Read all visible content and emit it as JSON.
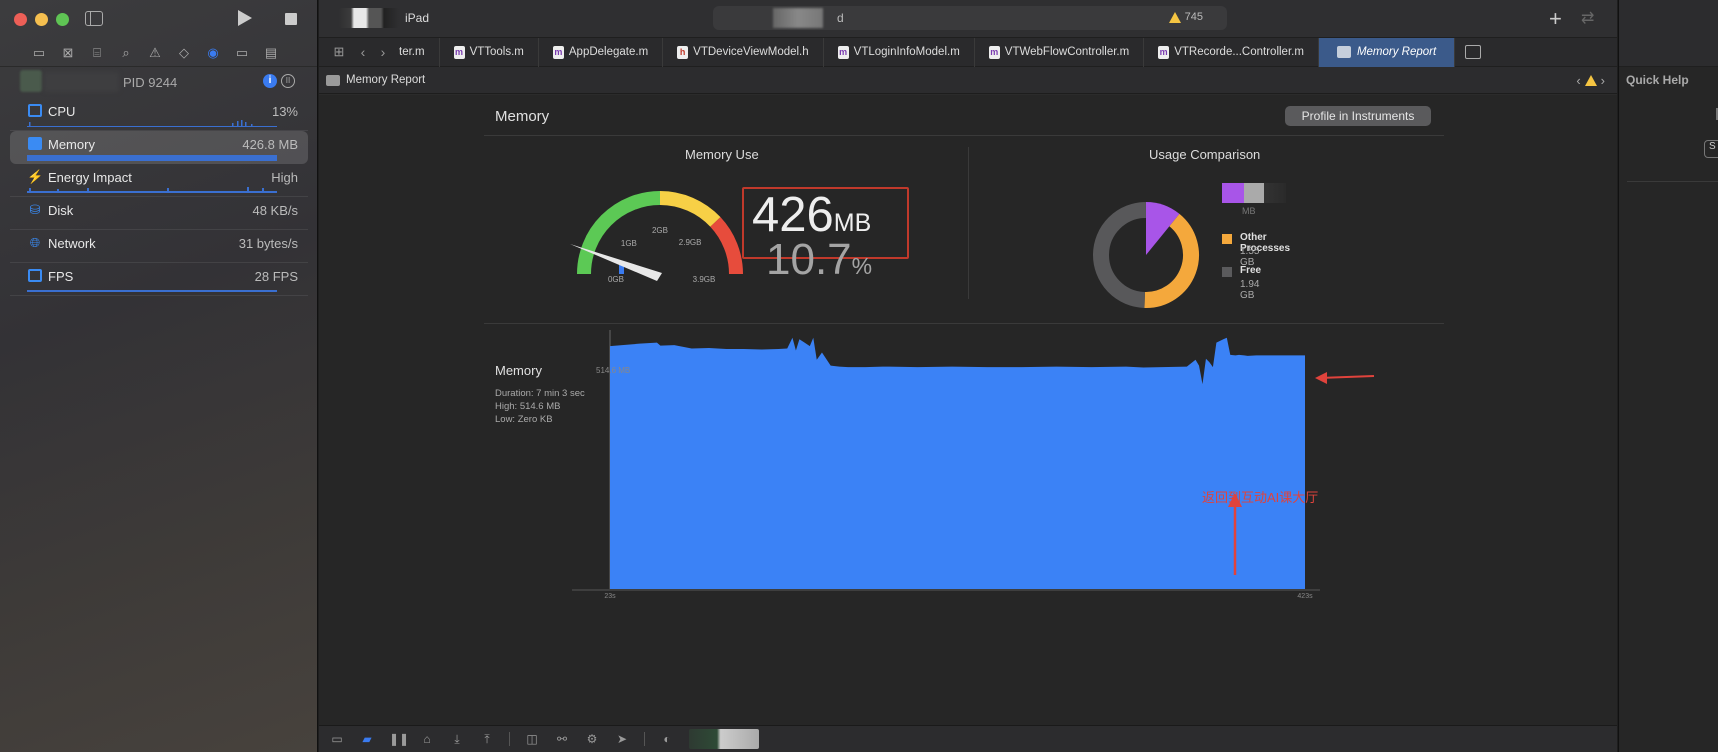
{
  "window": {
    "scheme_device": "iPad",
    "status_suffix": "d",
    "warning_count": "745"
  },
  "navigator_icons": [
    "folder-icon",
    "source-control-icon",
    "symbol-icon",
    "search-icon",
    "warning-icon",
    "test-icon",
    "debug-icon",
    "breakpoint-icon",
    "report-icon"
  ],
  "process": {
    "pid_label": "PID 9244"
  },
  "gauges": [
    {
      "name": "CPU",
      "value": "13%",
      "icon": "cpu-icon"
    },
    {
      "name": "Memory",
      "value": "426.8 MB",
      "icon": "memory-icon",
      "selected": true
    },
    {
      "name": "Energy Impact",
      "value": "High",
      "icon": "energy-icon"
    },
    {
      "name": "Disk",
      "value": "48 KB/s",
      "icon": "disk-icon"
    },
    {
      "name": "Network",
      "value": "31 bytes/s",
      "icon": "network-icon"
    },
    {
      "name": "FPS",
      "value": "28 FPS",
      "icon": "fps-icon"
    }
  ],
  "tabs": [
    {
      "label": "ter.m",
      "badge": ""
    },
    {
      "label": "VTTools.m",
      "badge": "m"
    },
    {
      "label": "AppDelegate.m",
      "badge": "m"
    },
    {
      "label": "VTDeviceViewModel.h",
      "badge": "h"
    },
    {
      "label": "VTLoginInfoModel.m",
      "badge": "m"
    },
    {
      "label": "VTWebFlowController.m",
      "badge": "m"
    },
    {
      "label": "VTRecorde...Controller.m",
      "badge": "m"
    },
    {
      "label": "Memory Report",
      "badge": "",
      "active": true
    }
  ],
  "pathbar": {
    "label": "Memory Report"
  },
  "report": {
    "title": "Memory",
    "profile_button": "Profile in Instruments",
    "memory_use": {
      "title": "Memory Use",
      "value": "426",
      "unit": "MB",
      "percent": "10.7",
      "percent_unit": "%",
      "gauge_labels": [
        "0GB",
        "1GB",
        "2GB",
        "2.9GB",
        "3.9GB"
      ],
      "gauge_max_gb": 3.9,
      "gauge_value_gb": 0.426
    },
    "usage_comparison": {
      "title": "Usage Comparison",
      "legend": [
        {
          "name": "",
          "value": "MB",
          "color": "#a855e8"
        },
        {
          "name": "Other Processes",
          "value": "1.55 GB",
          "color": "#f4a83c"
        },
        {
          "name": "Free",
          "value": "1.94 GB",
          "color": "#5a5a5c"
        }
      ]
    },
    "annotation": "返回到互动AI课大厅"
  },
  "chart_data": {
    "type": "area",
    "title": "Memory",
    "stats": [
      "Duration: 7 min 3 sec",
      "High: 514.6 MB",
      "Low: Zero KB"
    ],
    "y_max_label": "514.6 MB",
    "x_tick_labels": [
      "23s",
      "423s"
    ],
    "ylim": [
      0,
      514.6
    ],
    "xlim": [
      23,
      423
    ],
    "color": "#3b82f6",
    "x": [
      23,
      30,
      40,
      50,
      52,
      60,
      70,
      80,
      90,
      100,
      110,
      120,
      125,
      128,
      130,
      132,
      135,
      138,
      140,
      142,
      145,
      150,
      155,
      160,
      170,
      180,
      200,
      220,
      240,
      260,
      280,
      300,
      320,
      330,
      355,
      360,
      362,
      364,
      366,
      368,
      370,
      372,
      376,
      378,
      380,
      383,
      385,
      388,
      390,
      395,
      400,
      410,
      423
    ],
    "y": [
      498,
      500,
      503,
      505,
      499,
      500,
      493,
      494,
      492,
      492,
      491,
      492,
      493,
      515,
      489,
      512,
      505,
      498,
      515,
      470,
      485,
      458,
      456,
      455,
      455,
      456,
      455,
      456,
      455,
      455,
      456,
      455,
      456,
      454,
      456,
      470,
      458,
      420,
      472,
      465,
      455,
      505,
      512,
      515,
      480,
      479,
      480,
      479,
      478,
      479,
      479,
      479,
      479
    ]
  },
  "debug_icons": [
    "console-toggle-icon",
    "breakpoints-icon",
    "pause-icon",
    "step-over-icon",
    "step-into-icon",
    "step-out-icon",
    "view-hierarchy-icon",
    "memory-graph-icon",
    "environment-icon",
    "location-icon",
    "gpu-icon"
  ],
  "inspector": {
    "title": "Quick Help",
    "button": "S"
  }
}
